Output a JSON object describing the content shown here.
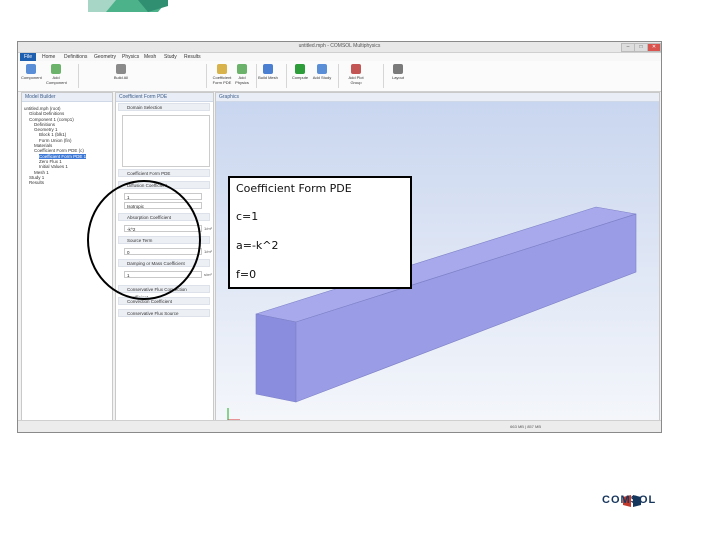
{
  "window": {
    "title": "untitled.mph - COMSOL Multiphysics",
    "buttons": [
      "–",
      "□",
      "✕"
    ]
  },
  "menu": {
    "file": "File",
    "items": [
      "Home",
      "Definitions",
      "Geometry",
      "Physics",
      "Mesh",
      "Study",
      "Results"
    ]
  },
  "ribbon": {
    "buttons": [
      {
        "label": "Component",
        "icon": "component-icon",
        "color": "#5a8fd8"
      },
      {
        "label": "Add Component",
        "icon": "add-component-icon",
        "color": "#6bb36b"
      },
      {
        "label": "Build All",
        "icon": "build-all-icon",
        "color": "#8a8a8a"
      },
      {
        "label": "Coefficient Form PDE",
        "icon": "pde-icon",
        "color": "#d8b24a"
      },
      {
        "label": "Add Physics",
        "icon": "add-physics-icon",
        "color": "#6bb36b"
      },
      {
        "label": "Build Mesh",
        "icon": "mesh-icon",
        "color": "#4a7fd1"
      },
      {
        "label": "Compute",
        "icon": "compute-icon",
        "color": "#2d9d3a"
      },
      {
        "label": "Add Study",
        "icon": "add-study-icon",
        "color": "#5a8fd8"
      },
      {
        "label": "Add Plot Group",
        "icon": "plot-icon",
        "color": "#c45555"
      },
      {
        "label": "Layout",
        "icon": "layout-icon",
        "color": "#7a7a7a"
      }
    ]
  },
  "model_builder": {
    "header": "Model Builder",
    "tree": [
      "untitled.mph (root)",
      "Global Definitions",
      "Component 1 (comp1)",
      "Definitions",
      "Geometry 1",
      "Block 1 (blk1)",
      "Form Union (fin)",
      "Materials",
      "Coefficient Form PDE (c)",
      "Coefficient Form PDE 1",
      "Zero Flux 1",
      "Initial Values 1",
      "Mesh 1",
      "Study 1",
      "Results"
    ],
    "selected_index": 9
  },
  "settings": {
    "header": "Coefficient Form PDE",
    "label": "Coefficient Form PDE",
    "sections": [
      {
        "title": "Domain Selection"
      },
      {
        "title": "Diffusion Coefficient",
        "value": "1",
        "unit": ""
      },
      {
        "title": "Absorption Coefficient",
        "value": "-k^2",
        "unit": "1/m²"
      },
      {
        "title": "Source Term",
        "value": "0",
        "unit": "1/m²"
      },
      {
        "title": "Damping or Mass Coefficient",
        "value": "1",
        "unit": "s/m²"
      },
      {
        "title": "Conservative Flux Convection Coefficient"
      },
      {
        "title": "Convection Coefficient"
      },
      {
        "title": "Conservative Flux Source"
      }
    ],
    "isotropic": "Isotropic"
  },
  "graphics": {
    "header": "Graphics"
  },
  "annotation": {
    "title": "Coefficient Form PDE",
    "c": "c=1",
    "a": "a=-k^2",
    "f": "f=0"
  },
  "status": {
    "memory": "663 MB | 857 MB"
  },
  "brand": {
    "logo": "COMSOL",
    "color": "#17365d"
  }
}
